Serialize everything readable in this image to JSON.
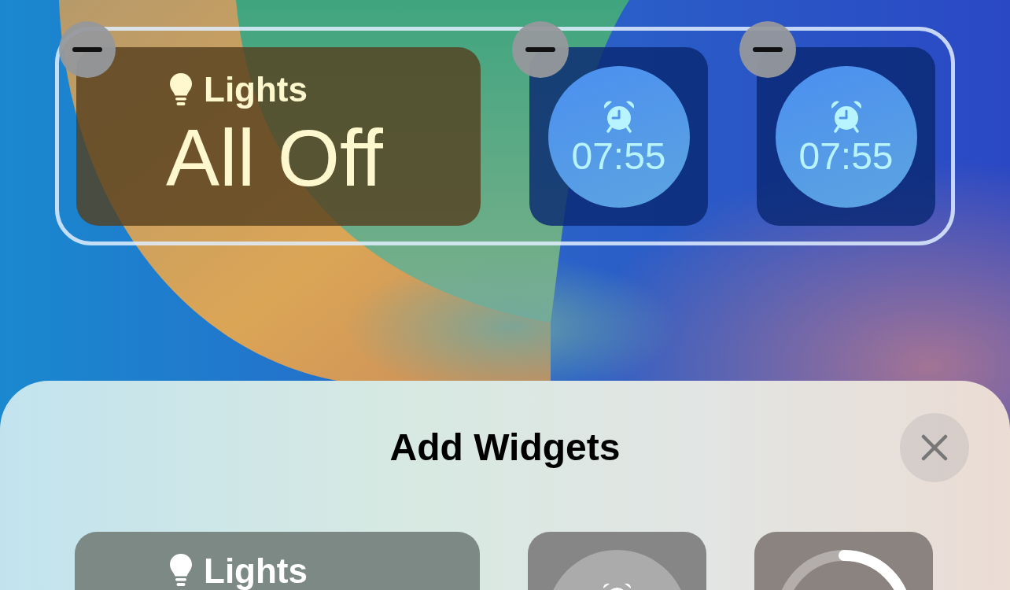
{
  "editing": true,
  "widgets": [
    {
      "kind": "lights",
      "title": "Lights",
      "status": "All Off"
    },
    {
      "kind": "alarm",
      "time": "07:55"
    },
    {
      "kind": "alarm",
      "time": "07:55"
    }
  ],
  "add_widgets_sheet": {
    "title": "Add Widgets",
    "previews": [
      {
        "kind": "lights",
        "title": "Lights"
      },
      {
        "kind": "alarm"
      },
      {
        "kind": "gauge"
      }
    ]
  }
}
